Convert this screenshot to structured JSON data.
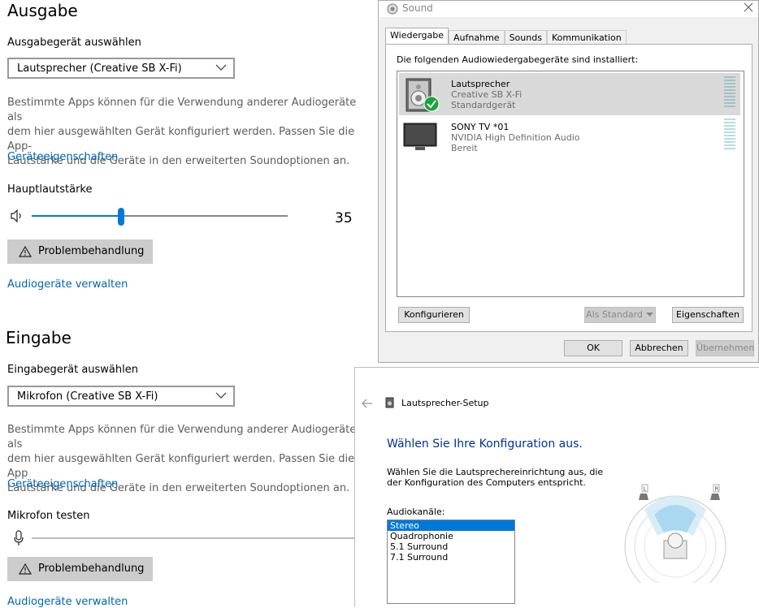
{
  "output": {
    "title": "Ausgabe",
    "device_label": "Ausgabegerät auswählen",
    "device_value": "Lautsprecher (Creative SB X-Fi)",
    "desc_lines": [
      "Bestimmte Apps können für die Verwendung anderer Audiogeräte als",
      "dem hier ausgewählten Gerät konfiguriert werden. Passen Sie die App-",
      "Lautstärke und die Geräte in den erweiterten Soundoptionen an."
    ],
    "properties_link": "Geräteeigenschaften",
    "volume_label": "Hauptlautstärke",
    "volume_value": "35",
    "volume_fraction": 0.35,
    "troubleshoot": "Problembehandlung",
    "manage_link": "Audiogeräte verwalten"
  },
  "input": {
    "title": "Eingabe",
    "device_label": "Eingabegerät auswählen",
    "device_value": "Mikrofon (Creative SB X-Fi)",
    "desc_lines": [
      "Bestimmte Apps können für die Verwendung anderer Audiogeräte als",
      "dem hier ausgewählten Gerät konfiguriert werden. Passen Sie die App",
      "Lautstärke und die Geräte in den erweiterten Soundoptionen an."
    ],
    "properties_link": "Geräteeigenschaften",
    "mic_test_label": "Mikrofon testen",
    "troubleshoot": "Problembehandlung",
    "manage_link": "Audiogeräte verwalten"
  },
  "sound_dialog": {
    "title": "Sound",
    "tabs": [
      "Wiedergabe",
      "Aufnahme",
      "Sounds",
      "Kommunikation"
    ],
    "heading": "Die folgenden Audiowiedergabegeräte sind installiert:",
    "devices": [
      {
        "name": "Lautsprecher",
        "line2": "Creative SB X-Fi",
        "line3": "Standardgerät"
      },
      {
        "name": "SONY TV  *01",
        "line2": "NVIDIA High Definition Audio",
        "line3": "Bereit"
      }
    ],
    "configure": "Konfigurieren",
    "set_default": "Als Standard",
    "properties": "Eigenschaften",
    "ok": "OK",
    "cancel": "Abbrechen",
    "apply": "Übernehmen"
  },
  "speaker_setup": {
    "title": "Lautsprecher-Setup",
    "heading": "Wählen Sie Ihre Konfiguration aus.",
    "desc_lines": [
      "Wählen Sie die Lautsprechereinrichtung aus, die",
      "der Konfiguration des Computers entspricht."
    ],
    "channels_label": "Audiokanäle:",
    "channels": [
      "Stereo",
      "Quadrophonie",
      "5.1 Surround",
      "7.1 Surround"
    ],
    "selected": "Stereo",
    "left_marker": "L",
    "right_marker": "R"
  },
  "colors": {
    "accent": "#0078d7",
    "link": "#0067b8",
    "check": "#1aa33b"
  }
}
